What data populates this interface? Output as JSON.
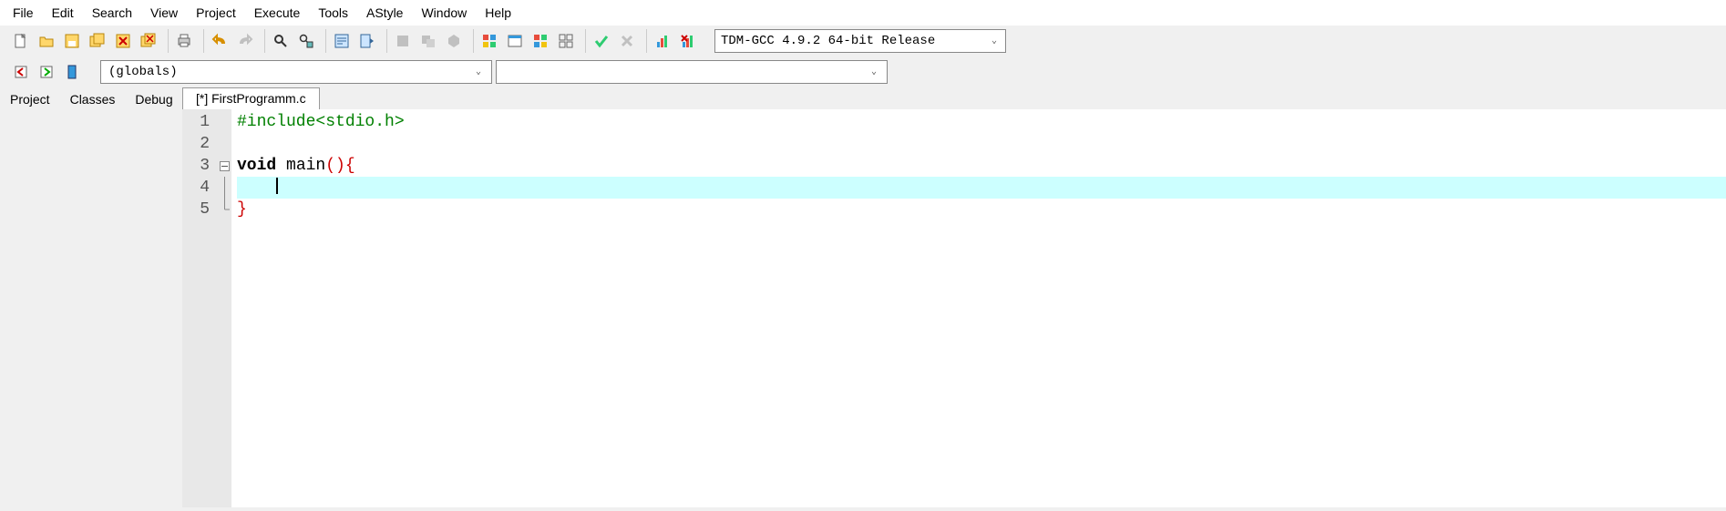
{
  "menu": {
    "items": [
      "File",
      "Edit",
      "Search",
      "View",
      "Project",
      "Execute",
      "Tools",
      "AStyle",
      "Window",
      "Help"
    ]
  },
  "toolbar": {
    "compiler": "TDM-GCC 4.9.2 64-bit Release"
  },
  "second_row": {
    "scope": "(globals)",
    "member": ""
  },
  "side_tabs": [
    "Project",
    "Classes",
    "Debug"
  ],
  "editor": {
    "tab": "[*] FirstProgramm.c",
    "lines": [
      {
        "num": "1",
        "tokens": [
          {
            "t": "#include<stdio.h>",
            "cls": "tok-pp"
          }
        ]
      },
      {
        "num": "2",
        "tokens": []
      },
      {
        "num": "3",
        "tokens": [
          {
            "t": "void",
            "cls": "tok-kw"
          },
          {
            "t": " main",
            "cls": "tok-fn"
          },
          {
            "t": "()",
            "cls": "tok-paren"
          },
          {
            "t": "{",
            "cls": "tok-brace"
          }
        ],
        "fold": "box"
      },
      {
        "num": "4",
        "tokens": [],
        "hl": true,
        "cursor": true,
        "fold": "line"
      },
      {
        "num": "5",
        "tokens": [
          {
            "t": "}",
            "cls": "tok-brace"
          }
        ],
        "fold": "end"
      }
    ]
  }
}
